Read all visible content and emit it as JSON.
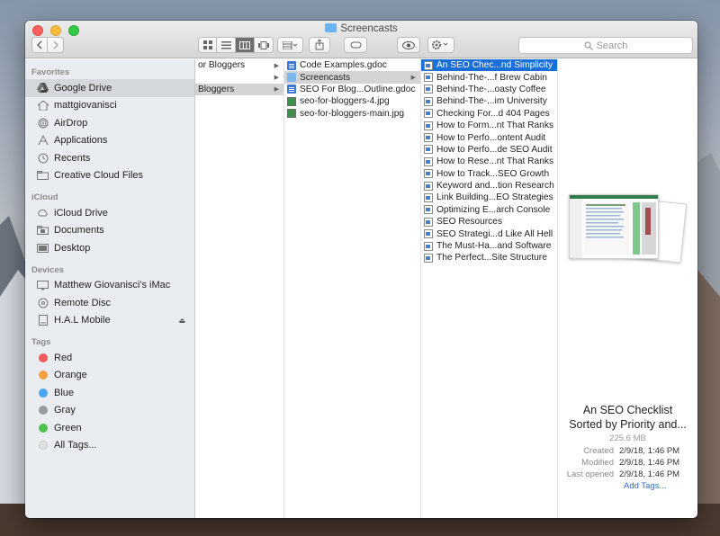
{
  "window": {
    "title": "Screencasts",
    "search_placeholder": "Search"
  },
  "sidebar": {
    "favorites_title": "Favorites",
    "favorites": [
      {
        "label": "Google Drive",
        "icon": "google-drive-icon",
        "selected": true
      },
      {
        "label": "mattgiovanisci",
        "icon": "home-icon"
      },
      {
        "label": "AirDrop",
        "icon": "airdrop-icon"
      },
      {
        "label": "Applications",
        "icon": "applications-icon"
      },
      {
        "label": "Recents",
        "icon": "clock-icon"
      },
      {
        "label": "Creative Cloud Files",
        "icon": "folder-icon"
      }
    ],
    "icloud_title": "iCloud",
    "icloud": [
      {
        "label": "iCloud Drive",
        "icon": "cloud-icon"
      },
      {
        "label": "Documents",
        "icon": "documents-icon"
      },
      {
        "label": "Desktop",
        "icon": "desktop-icon"
      }
    ],
    "devices_title": "Devices",
    "devices": [
      {
        "label": "Matthew Giovanisci's iMac",
        "icon": "imac-icon"
      },
      {
        "label": "Remote Disc",
        "icon": "disc-icon"
      },
      {
        "label": "H.A.L Mobile",
        "icon": "drive-icon",
        "eject": "⏏"
      }
    ],
    "tags_title": "Tags",
    "tags": [
      {
        "label": "Red",
        "color": "#f05a5a"
      },
      {
        "label": "Orange",
        "color": "#f5a042"
      },
      {
        "label": "Blue",
        "color": "#4aa6f0"
      },
      {
        "label": "Gray",
        "color": "#9a9a9a"
      },
      {
        "label": "Green",
        "color": "#4ec14e"
      },
      {
        "label": "All Tags...",
        "color": "#e0e0e0"
      }
    ]
  },
  "columns": {
    "col1": [
      {
        "label": "or Bloggers",
        "arrow": "▶"
      },
      {
        "label": "",
        "arrow": "▶"
      },
      {
        "label": "Bloggers",
        "arrow": "▶",
        "selected": true
      }
    ],
    "col2": [
      {
        "label": "Code Examples.gdoc",
        "kind": "doc"
      },
      {
        "label": "Screencasts",
        "kind": "folder",
        "arrow": "▶",
        "selected": true
      },
      {
        "label": "SEO For Blog...Outline.gdoc",
        "kind": "doc"
      },
      {
        "label": "seo-for-bloggers-4.jpg",
        "kind": "img"
      },
      {
        "label": "seo-for-bloggers-main.jpg",
        "kind": "img"
      }
    ],
    "col3": [
      "An SEO Chec...nd Simplicity",
      "Behind-The-...f Brew Cabin",
      "Behind-The-...oasty Coffee",
      "Behind-The-...im University",
      "Checking For...d 404 Pages",
      "How to Form...nt That Ranks",
      "How to Perfo...ontent Audit",
      "How to Perfo...de SEO Audit",
      "How to Rese...nt That Ranks",
      "How to Track...SEO Growth",
      "Keyword and...tion Research",
      "Link Building...EO Strategies",
      "Optimizing E...arch Console",
      "SEO Resources",
      "SEO Strategi...d Like All Hell",
      "The Must-Ha...and Software",
      "The Perfect...Site Structure"
    ]
  },
  "preview": {
    "title_line1": "An SEO Checklist",
    "title_line2": "Sorted by Priority and...",
    "size": "225.6 MB",
    "created_label": "Created",
    "created": "2/9/18, 1:46 PM",
    "modified_label": "Modified",
    "modified": "2/9/18, 1:46 PM",
    "opened_label": "Last opened",
    "opened": "2/9/18, 1:46 PM",
    "add_tags": "Add Tags..."
  }
}
